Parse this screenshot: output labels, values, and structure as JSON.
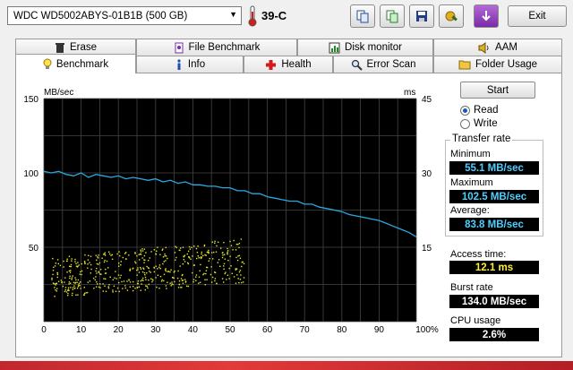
{
  "toolbar": {
    "drive": "WDC WD5002ABYS-01B1B (500 GB)",
    "temperature": "39-C",
    "exit_label": "Exit"
  },
  "tabs_row1": [
    {
      "label": "Erase",
      "icon": "trash-icon"
    },
    {
      "label": "File Benchmark",
      "icon": "file-benchmark-icon"
    },
    {
      "label": "Disk monitor",
      "icon": "disk-monitor-icon"
    },
    {
      "label": "AAM",
      "icon": "speaker-icon"
    }
  ],
  "tabs_row2": [
    {
      "label": "Benchmark",
      "icon": "lightbulb-icon",
      "active": true
    },
    {
      "label": "Info",
      "icon": "info-icon"
    },
    {
      "label": "Health",
      "icon": "health-cross-icon"
    },
    {
      "label": "Error Scan",
      "icon": "magnifier-icon"
    },
    {
      "label": "Folder Usage",
      "icon": "folder-icon"
    }
  ],
  "controls": {
    "start_label": "Start",
    "read_label": "Read",
    "write_label": "Write",
    "selected": "Read"
  },
  "stats": {
    "transfer_rate_label": "Transfer rate",
    "minimum_label": "Minimum",
    "minimum": "55.1 MB/sec",
    "maximum_label": "Maximum",
    "maximum": "102.5 MB/sec",
    "average_label": "Average:",
    "average": "83.8 MB/sec",
    "access_time_label": "Access time:",
    "access_time": "12.1 ms",
    "burst_rate_label": "Burst rate",
    "burst_rate": "134.0 MB/sec",
    "cpu_usage_label": "CPU usage",
    "cpu_usage": "2.6%"
  },
  "colors": {
    "plot_bg": "#000000",
    "grid": "#444444",
    "transfer_line": "#2aa8e0",
    "access_points": "#e6e62a"
  },
  "chart_data": {
    "type": "line",
    "ylabel_left": "MB/sec",
    "ylabel_right": "ms",
    "x_ticks": [
      "0",
      "10",
      "20",
      "30",
      "40",
      "50",
      "60",
      "70",
      "80",
      "90",
      "100%"
    ],
    "y_left_ticks": [
      "150",
      "100",
      "50"
    ],
    "y_right_ticks": [
      "45",
      "30",
      "15"
    ],
    "xlim": [
      0,
      100
    ],
    "ylim_left": [
      0,
      150
    ],
    "ylim_right": [
      0,
      45
    ],
    "grid": true,
    "series": [
      {
        "name": "Transfer rate",
        "x": [
          0,
          2,
          4,
          6,
          8,
          10,
          12,
          14,
          16,
          18,
          20,
          22,
          24,
          26,
          28,
          30,
          32,
          34,
          36,
          38,
          40,
          42,
          44,
          46,
          48,
          50,
          52,
          54,
          56,
          58,
          60,
          62,
          64,
          66,
          68,
          70,
          72,
          74,
          76,
          78,
          80,
          82,
          84,
          86,
          88,
          90,
          92,
          94,
          96,
          98,
          100
        ],
        "values": [
          101,
          100,
          101,
          99,
          98,
          100,
          97,
          99,
          98,
          97,
          98,
          96,
          97,
          96,
          95,
          96,
          94,
          95,
          93,
          94,
          92,
          92,
          91,
          91,
          90,
          90,
          88,
          88,
          86,
          86,
          84,
          83,
          82,
          81,
          81,
          79,
          79,
          77,
          76,
          75,
          74,
          72,
          71,
          70,
          69,
          68,
          66,
          64,
          62,
          60,
          57
        ]
      },
      {
        "name": "Access time",
        "type": "scatter",
        "x_range": [
          2,
          54
        ],
        "y_range_ms": [
          5,
          17
        ],
        "count": 520
      }
    ]
  }
}
